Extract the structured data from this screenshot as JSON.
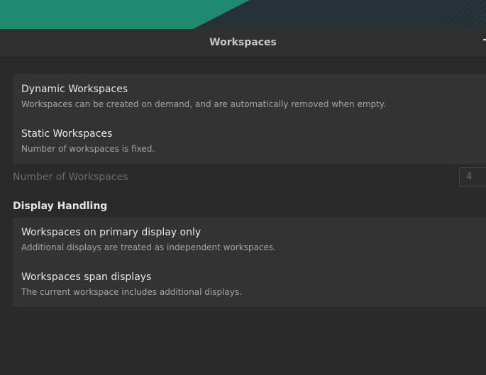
{
  "window": {
    "title": "Workspaces"
  },
  "workspace_mode": {
    "options": [
      {
        "title": "Dynamic Workspaces",
        "subtitle": "Workspaces can be created on demand, and are automatically removed when empty."
      },
      {
        "title": "Static Workspaces",
        "subtitle": "Number of workspaces is fixed."
      }
    ]
  },
  "number_of_workspaces": {
    "label": "Number of Workspaces",
    "value": "4"
  },
  "display_handling": {
    "heading": "Display Handling",
    "options": [
      {
        "title": "Workspaces on primary display only",
        "subtitle": "Additional displays are treated as independent workspaces."
      },
      {
        "title": "Workspaces span displays",
        "subtitle": "The current workspace includes additional displays."
      }
    ]
  },
  "colors": {
    "accent": "#1f8a70",
    "window_bg": "#2a2a2a",
    "row_bg": "#333333"
  }
}
